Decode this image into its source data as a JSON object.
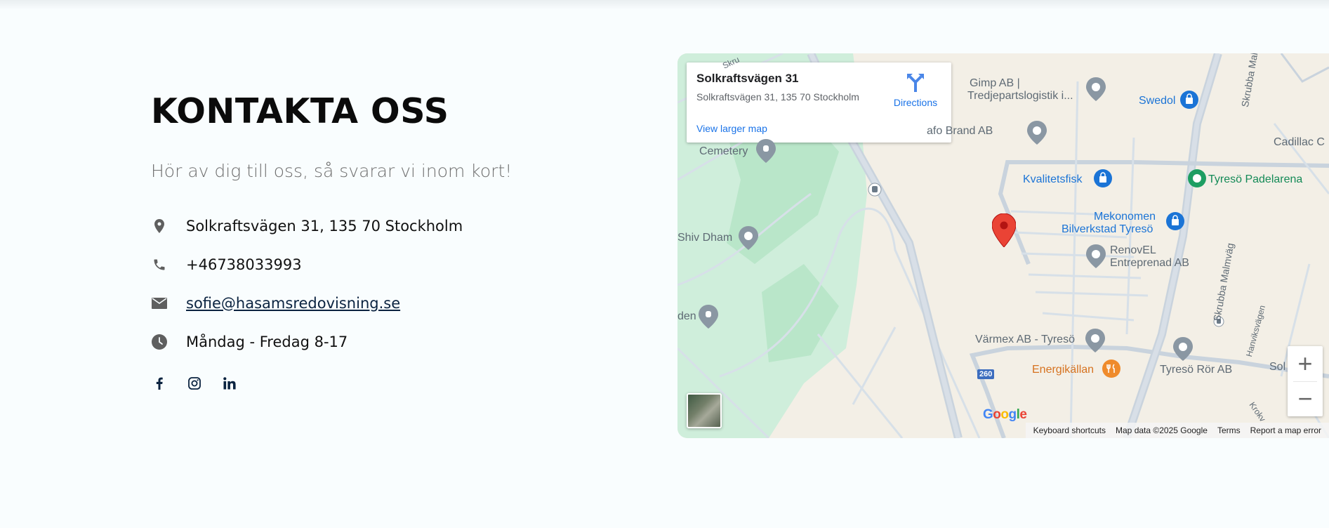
{
  "contact": {
    "title": "KONTAKTA OSS",
    "subtitle": "Hör av dig till oss, så svarar vi inom kort!",
    "address": "Solkraftsvägen 31, 135 70 Stockholm",
    "phone": "+46738033993",
    "email": "sofie@hasamsredovisning.se",
    "hours": "Måndag - Fredag 8-17",
    "icons": [
      "location-pin-icon",
      "phone-icon",
      "email-icon",
      "clock-icon"
    ],
    "socials": [
      "facebook-icon",
      "instagram-icon",
      "linkedin-icon"
    ]
  },
  "map": {
    "card": {
      "title": "Solkraftsvägen 31",
      "address": "Solkraftsvägen 31, 135 70 Stockholm",
      "directions": "Directions",
      "larger_map": "View larger map"
    },
    "labels": {
      "gimp": "Gimp AB |",
      "tredje": "Tredjepartslogistik i...",
      "swedol": "Swedol",
      "skrubba_top": "Skrubba Malmväg",
      "cadillac": "Cadillac C",
      "safo": "afo Brand AB",
      "cemetery": "Cemetery",
      "kvalitetsfisk": "Kvalitetsfisk",
      "padel": "Tyresö Padelarena",
      "mekonomen": "Mekonomen",
      "bilverkstad": "Bilverkstad Tyresö",
      "shivdham": "Shiv Dham",
      "renovel": "RenovEL",
      "entreprenad": "Entreprenad AB",
      "skrubba_mid": "Skrubba Malmväg",
      "den": "den",
      "hanviks": "Hanviksvägen",
      "varmex": "Värmex AB - Tyresö",
      "energikallan": "Energikällan",
      "tyreso_ror": "Tyresö Rör AB",
      "sol": "Sol",
      "krok": "Krokv",
      "skru": "Skru",
      "road_260": "260"
    },
    "zoom_in": "+",
    "zoom_out": "−",
    "google": "Google",
    "attribution": {
      "shortcuts": "Keyboard shortcuts",
      "data": "Map data ©2025 Google",
      "terms": "Terms",
      "report": "Report a map error"
    },
    "colors": {
      "land": "#f3efe6",
      "park": "#cfeedb",
      "park_dark": "#b9e6c9",
      "road": "#c9d3dd",
      "pin": "#ea4335",
      "poi_grey": "#8a97a3",
      "poi_blue": "#1b74d6",
      "poi_green": "#1e9e62",
      "poi_orange": "#ef8b2c"
    }
  }
}
